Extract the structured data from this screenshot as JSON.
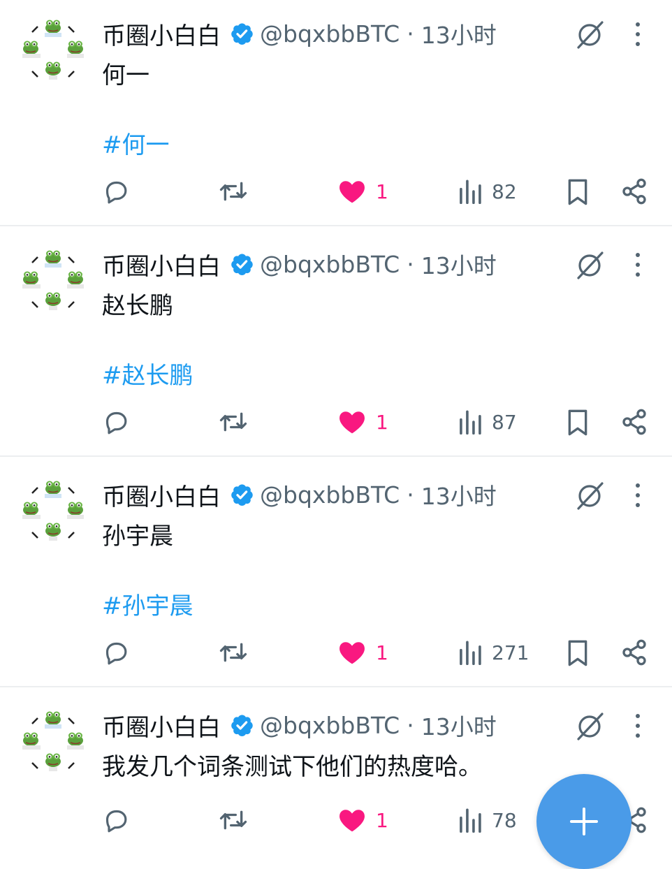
{
  "tweets": [
    {
      "user": "币圈小白白",
      "handle": "@bqxbbBTC",
      "separator": "·",
      "time": "13小时",
      "text": "何一",
      "hashtag": "#何一",
      "likes": "1",
      "views": "82"
    },
    {
      "user": "币圈小白白",
      "handle": "@bqxbbBTC",
      "separator": "·",
      "time": "13小时",
      "text": "赵长鹏",
      "hashtag": "#赵长鹏",
      "likes": "1",
      "views": "87"
    },
    {
      "user": "币圈小白白",
      "handle": "@bqxbbBTC",
      "separator": "·",
      "time": "13小时",
      "text": "孙宇晨",
      "hashtag": "#孙宇晨",
      "likes": "1",
      "views": "271"
    },
    {
      "user": "币圈小白白",
      "handle": "@bqxbbBTC",
      "separator": "·",
      "time": "13小时",
      "text": "我发几个词条测试下他们的热度哈。",
      "hashtag": "",
      "likes": "1",
      "views": "78"
    }
  ],
  "icons": {
    "verified": "verified-badge-icon",
    "grok": "grok-icon",
    "more": "more-vertical-icon",
    "reply": "reply-icon",
    "retweet": "retweet-icon",
    "like": "heart-icon",
    "views": "views-icon",
    "bookmark": "bookmark-icon",
    "share": "share-icon",
    "compose": "plus-icon"
  },
  "colors": {
    "accent": "#1d9bf0",
    "like": "#f91880",
    "secondary_text": "#536471",
    "fab": "#4a9be8"
  }
}
